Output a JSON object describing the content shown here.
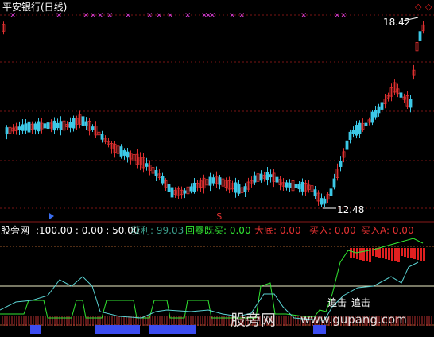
{
  "title": "平安银行(日线)",
  "price": {
    "high_label": "18.42",
    "low_label": "12.48"
  },
  "dollar_marker": "$",
  "indicator": {
    "name": "股旁网",
    "params": ":100.00 : 0.00 : 50.00",
    "items": [
      {
        "label": "获利: 99.03",
        "color": "#3c9e8c"
      },
      {
        "label": "回零既买: 0.00",
        "color": "#32e632"
      },
      {
        "label": "大底: 0.00",
        "color": "#e63232"
      },
      {
        "label": "买入: 0.00",
        "color": "#e63232"
      },
      {
        "label": "买入A: 0.00",
        "color": "#e63232"
      }
    ]
  },
  "signals": [
    "追击",
    "追击"
  ],
  "watermark": {
    "cn": "股旁网",
    "url": "www.gupang.com"
  },
  "colors": {
    "up": "#e03030",
    "down": "#3cc8e6",
    "ma": "#ffffff",
    "marker": "#e040e0"
  }
}
